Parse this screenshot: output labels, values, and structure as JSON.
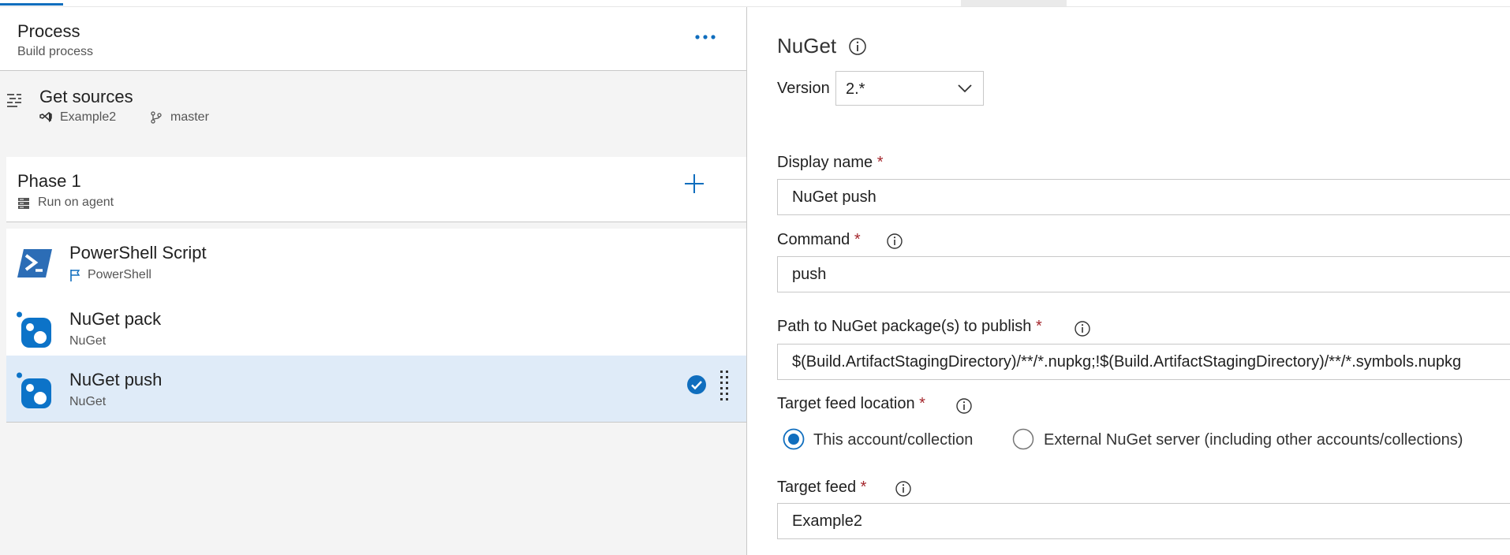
{
  "left": {
    "process": {
      "title": "Process",
      "subtitle": "Build process",
      "more_icon": "ellipsis-icon"
    },
    "get_sources": {
      "title": "Get sources",
      "repo": "Example2",
      "branch": "master"
    },
    "phase": {
      "title": "Phase 1",
      "subtitle": "Run on agent"
    },
    "tasks": [
      {
        "title": "PowerShell Script",
        "subtitle": "PowerShell",
        "icon": "powershell-icon"
      },
      {
        "title": "NuGet pack",
        "subtitle": "NuGet",
        "icon": "nuget-icon"
      },
      {
        "title": "NuGet push",
        "subtitle": "NuGet",
        "icon": "nuget-icon",
        "selected": true
      }
    ]
  },
  "right": {
    "title": "NuGet",
    "version": {
      "label": "Version",
      "value": "2.*"
    },
    "display_name": {
      "label": "Display name",
      "required": "*",
      "value": "NuGet push"
    },
    "command": {
      "label": "Command",
      "required": "*",
      "value": "push"
    },
    "path": {
      "label": "Path to NuGet package(s) to publish",
      "required": "*",
      "value": "$(Build.ArtifactStagingDirectory)/**/*.nupkg;!$(Build.ArtifactStagingDirectory)/**/*.symbols.nupkg"
    },
    "target_location": {
      "label": "Target feed location",
      "required": "*",
      "options": [
        {
          "label": "This account/collection",
          "selected": true
        },
        {
          "label": "External NuGet server (including other accounts/collections)",
          "selected": false
        }
      ]
    },
    "target_feed": {
      "label": "Target feed",
      "required": "*",
      "value": "Example2"
    }
  },
  "colors": {
    "accent": "#106ebe",
    "selected_row": "#dfebf8",
    "required": "#a4262c",
    "left_bg": "#f4f4f4"
  }
}
